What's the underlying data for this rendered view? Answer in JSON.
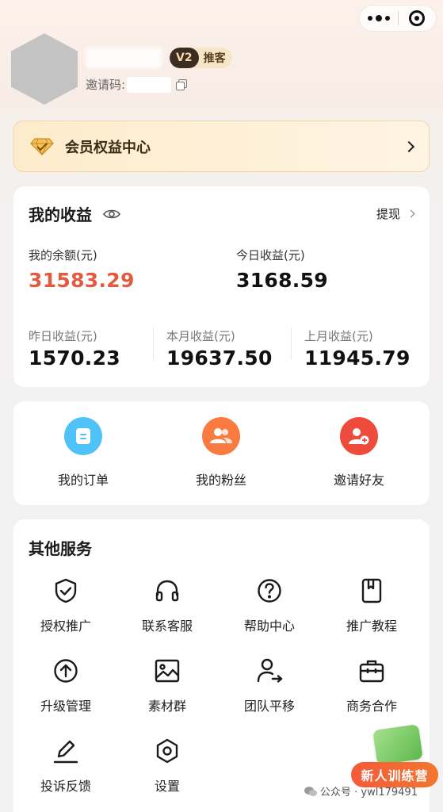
{
  "capsule": {
    "more_icon": "more-dots-icon",
    "close_icon": "close-circle-icon"
  },
  "profile": {
    "level": "V2",
    "role": "推客",
    "invite_label": "邀请码:"
  },
  "member": {
    "title": "会员权益中心",
    "icon": "diamond-icon"
  },
  "earnings": {
    "title": "我的收益",
    "withdraw_label": "提现",
    "balance_label": "我的余额(元)",
    "balance_value": "31583.29",
    "today_label": "今日收益(元)",
    "today_value": "3168.59",
    "yesterday_label": "昨日收益(元)",
    "yesterday_value": "1570.23",
    "month_label": "本月收益(元)",
    "month_value": "19637.50",
    "last_month_label": "上月收益(元)",
    "last_month_value": "11945.79"
  },
  "quick": [
    {
      "label": "我的订单",
      "icon": "order-icon",
      "color": "#4fc3f7"
    },
    {
      "label": "我的粉丝",
      "icon": "fans-icon",
      "color": "#f97b3f"
    },
    {
      "label": "邀请好友",
      "icon": "invite-user-icon",
      "color": "#ee4b3d"
    }
  ],
  "services": {
    "title": "其他服务",
    "items": [
      {
        "label": "授权推广",
        "icon": "shield-icon"
      },
      {
        "label": "联系客服",
        "icon": "headset-icon"
      },
      {
        "label": "帮助中心",
        "icon": "help-icon"
      },
      {
        "label": "推广教程",
        "icon": "bookmark-icon"
      },
      {
        "label": "升级管理",
        "icon": "upgrade-icon"
      },
      {
        "label": "素材群",
        "icon": "image-icon"
      },
      {
        "label": "团队平移",
        "icon": "user-transfer-icon"
      },
      {
        "label": "商务合作",
        "icon": "briefcase-icon"
      },
      {
        "label": "投诉反馈",
        "icon": "edit-icon"
      },
      {
        "label": "设置",
        "icon": "settings-icon"
      }
    ]
  },
  "promo": {
    "label": "新人训练营"
  },
  "watermark": {
    "source": "公众号 · ywl179491"
  }
}
